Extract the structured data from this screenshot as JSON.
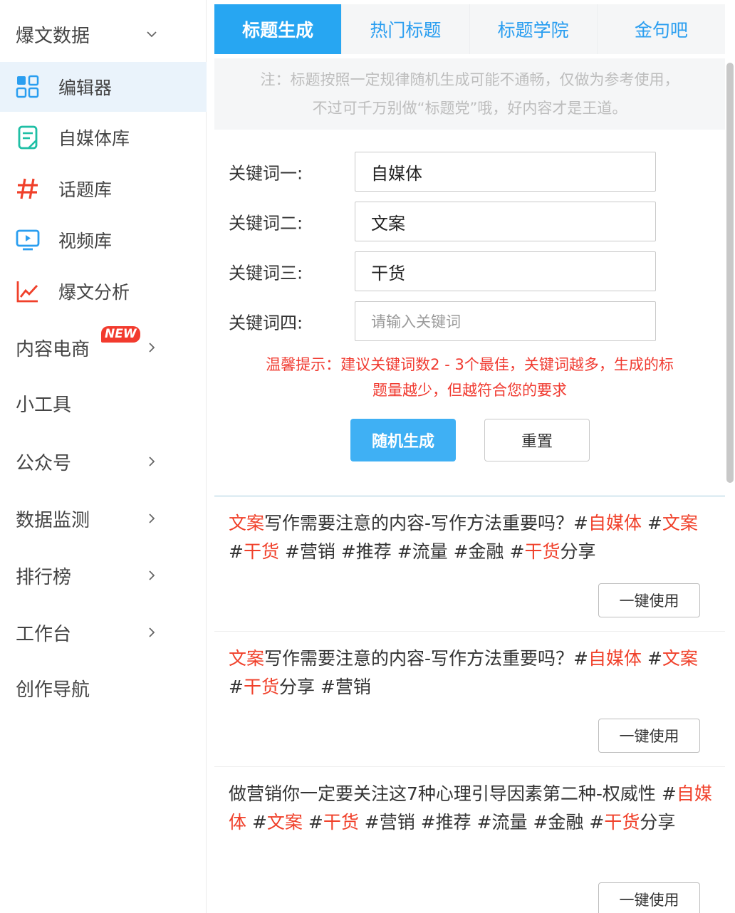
{
  "sidebar": {
    "items": [
      {
        "label": "爆文数据",
        "kind": "group",
        "chevron": "chevron-down-icon"
      },
      {
        "label": "编辑器",
        "kind": "item",
        "icon": "grid-icon",
        "active": true
      },
      {
        "label": "自媒体库",
        "kind": "item",
        "icon": "document-icon"
      },
      {
        "label": "话题库",
        "kind": "item",
        "icon": "hashtag-icon"
      },
      {
        "label": "视频库",
        "kind": "item",
        "icon": "video-icon"
      },
      {
        "label": "爆文分析",
        "kind": "item",
        "icon": "line-chart-icon"
      },
      {
        "label": "内容电商",
        "kind": "group",
        "chevron": "chevron-right-icon",
        "badge": "NEW"
      },
      {
        "label": "小工具",
        "kind": "group"
      },
      {
        "label": "公众号",
        "kind": "group",
        "chevron": "chevron-right-icon"
      },
      {
        "label": "数据监测",
        "kind": "group",
        "chevron": "chevron-right-icon"
      },
      {
        "label": "排行榜",
        "kind": "group",
        "chevron": "chevron-right-icon"
      },
      {
        "label": "工作台",
        "kind": "group",
        "chevron": "chevron-right-icon"
      },
      {
        "label": "创作导航",
        "kind": "group"
      }
    ],
    "colors": {
      "active_bg": "#eaf3fb",
      "badge": "#f23b2e",
      "icon_blue": "#2a9ef0",
      "icon_teal": "#1fbfa5",
      "icon_red": "#f0402a"
    }
  },
  "tabs": [
    {
      "label": "标题生成",
      "active": true
    },
    {
      "label": "热门标题",
      "active": false
    },
    {
      "label": "标题学院",
      "active": false
    },
    {
      "label": "金句吧",
      "active": false
    }
  ],
  "note": {
    "line1": "注：标题按照一定规律随机生成可能不通畅，仅做为参考使用，",
    "line2": "不过可千万别做“标题党”哦，好内容才是王道。"
  },
  "keywords": [
    {
      "label": "关键词一:",
      "value": "自媒体",
      "placeholder": "请输入关键词"
    },
    {
      "label": "关键词二:",
      "value": "文案",
      "placeholder": "请输入关键词"
    },
    {
      "label": "关键词三:",
      "value": "干货",
      "placeholder": "请输入关键词"
    },
    {
      "label": "关键词四:",
      "value": "",
      "placeholder": "请输入关键词"
    }
  ],
  "tip": {
    "line1": "温馨提示：建议关键词数2 - 3个最佳，关键词越多，生成的标",
    "line2": "题量越少，但越符合您的要求"
  },
  "buttons": {
    "generate": "随机生成",
    "reset": "重置",
    "use": "一键使用"
  },
  "results": [
    {
      "segments": [
        {
          "t": "文案",
          "hl": true
        },
        {
          "t": "写作需要注意的内容-写作方法重要吗？#",
          "hl": false
        },
        {
          "t": "自媒体",
          "hl": true
        },
        {
          "t": " #",
          "hl": false
        },
        {
          "t": "文案",
          "hl": true
        },
        {
          "t": " #",
          "hl": false
        },
        {
          "t": "干货",
          "hl": true
        },
        {
          "t": " #营销 #推荐 #流量 #金融 #",
          "hl": false
        },
        {
          "t": "干货",
          "hl": true
        },
        {
          "t": "分享",
          "hl": false
        }
      ]
    },
    {
      "segments": [
        {
          "t": "文案",
          "hl": true
        },
        {
          "t": "写作需要注意的内容-写作方法重要吗？#",
          "hl": false
        },
        {
          "t": "自媒体",
          "hl": true
        },
        {
          "t": " #",
          "hl": false
        },
        {
          "t": "文案",
          "hl": true
        },
        {
          "t": " #",
          "hl": false
        },
        {
          "t": "干货",
          "hl": true
        },
        {
          "t": "分享 #营销",
          "hl": false
        }
      ]
    },
    {
      "segments": [
        {
          "t": "做营销你一定要关注这7种心理引导因素第二种-权威性 #",
          "hl": false
        },
        {
          "t": "自媒体",
          "hl": true
        },
        {
          "t": " #",
          "hl": false
        },
        {
          "t": "文案",
          "hl": true
        },
        {
          "t": " #",
          "hl": false
        },
        {
          "t": "干货",
          "hl": true
        },
        {
          "t": " #营销 #推荐 #流量 #金融 #",
          "hl": false
        },
        {
          "t": "干货",
          "hl": true
        },
        {
          "t": "分享",
          "hl": false
        }
      ]
    }
  ],
  "colors": {
    "tab_active": "#27a6f2",
    "tab_text": "#2a9ef0",
    "highlight": "#f0402a",
    "tip": "#f03a30",
    "primary_btn": "#3fb0f4"
  }
}
